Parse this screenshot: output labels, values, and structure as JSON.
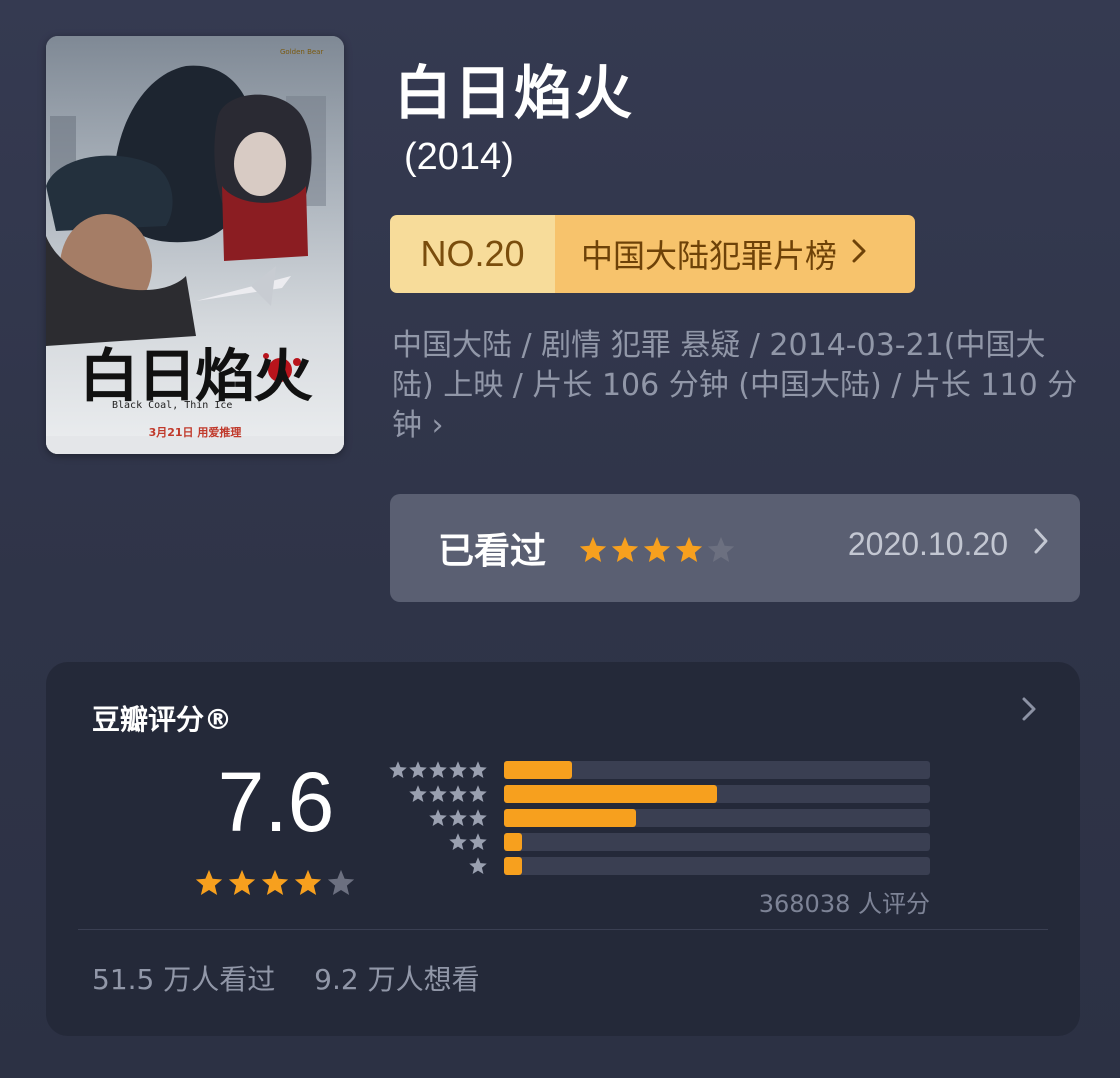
{
  "movie": {
    "title": "白日焰火",
    "year": "(2014)",
    "poster": {
      "title_art": "白日焰火",
      "english_title": "Black Coal, Thin Ice",
      "release_text": "3月21日 用爱推理",
      "festival_badge": "Golden Bear"
    }
  },
  "rank": {
    "number": "NO.20",
    "list_name": "中国大陆犯罪片榜",
    "chevron": "chevron-right-icon"
  },
  "meta_text": "中国大陆 / 剧情 犯罪 悬疑 / 2014-03-21(中国大陆) 上映 / 片长 106 分钟 (中国大陆) / 片长 110 分钟",
  "meta_chevron": "›",
  "watched": {
    "label": "已看过",
    "user_stars": 4,
    "date": "2020.10.20",
    "chevron": "›"
  },
  "douban_rating": {
    "title": "豆瓣评分®",
    "chevron": "›",
    "score": "7.6",
    "score_stars": 4,
    "distribution": [
      {
        "stars": 5,
        "fraction": 0.16
      },
      {
        "stars": 4,
        "fraction": 0.5
      },
      {
        "stars": 3,
        "fraction": 0.31
      },
      {
        "stars": 2,
        "fraction": 0.04
      },
      {
        "stars": 1,
        "fraction": 0.04
      }
    ],
    "count_text": "368038 人评分",
    "watched_count": "51.5 万人看过",
    "want_count": "9.2 万人想看"
  },
  "colors": {
    "star_on": "#f7a01e",
    "star_off": "#6c7080",
    "dist_star": "#9aa0b0",
    "bar_fill": "#f7a01e"
  }
}
